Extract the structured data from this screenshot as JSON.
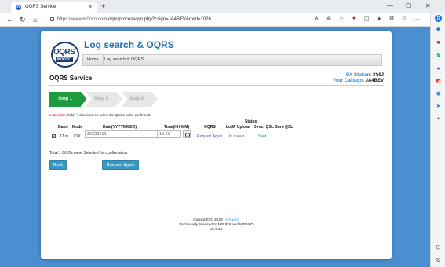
{
  "browser": {
    "tab_title": "OQRS Service",
    "tab_icon": "wordpress-icon",
    "url_host": "https://www.m0oxo.com",
    "url_path": "/oqrs/processqso.php?csign=JA4BEV&dxid=1026"
  },
  "site": {
    "title": "Log search & OQRS",
    "logo_text": "OQRS",
    "logo_call": "M0OXO",
    "menu": [
      "Home",
      "Log search & OQRS"
    ]
  },
  "service": {
    "title": "OQRS Service",
    "dx_label": "DX Station:",
    "dx_value": "3Y0J",
    "callsign_label": "Your Callsign:",
    "callsign_value": "JA4BEV"
  },
  "steps": [
    "Step 1",
    "Step 2",
    "Step 3"
  ],
  "instruction": {
    "prefix": "Instruction",
    "text": " Tick(✓) checkbox to select the QSOs to be confirmed."
  },
  "table": {
    "status_header": "Status",
    "headers": [
      "Band",
      "Mode",
      "Date(YYYYMMDD)",
      "Time(HH:MM)",
      "OQRS",
      "LotW Upload",
      "Direct QSL",
      "Buro QSL"
    ],
    "row": {
      "checked": true,
      "band": "17 m",
      "mode": "CW",
      "date": "20230213",
      "time": "15:29",
      "oqrs": "Request Again",
      "lotw": "In queue",
      "direct": "Sent",
      "buro": ""
    }
  },
  "total_text": "Total 1 QSOs were Selected for confirmation.",
  "buttons": {
    "back": "Back",
    "request": "Request Again"
  },
  "footer": {
    "copyright_prefix": "Copyright © 2023 - ",
    "copyright_link": "HA&AO",
    "line2": "Exclusively licensed to M0URX and M0OXO",
    "version": "v5.7.10"
  },
  "colors": {
    "accent": "#1f6fb8",
    "step_active": "#1e9b3e",
    "button": "#3a97c4",
    "page_bg": "#4a8fd0"
  }
}
